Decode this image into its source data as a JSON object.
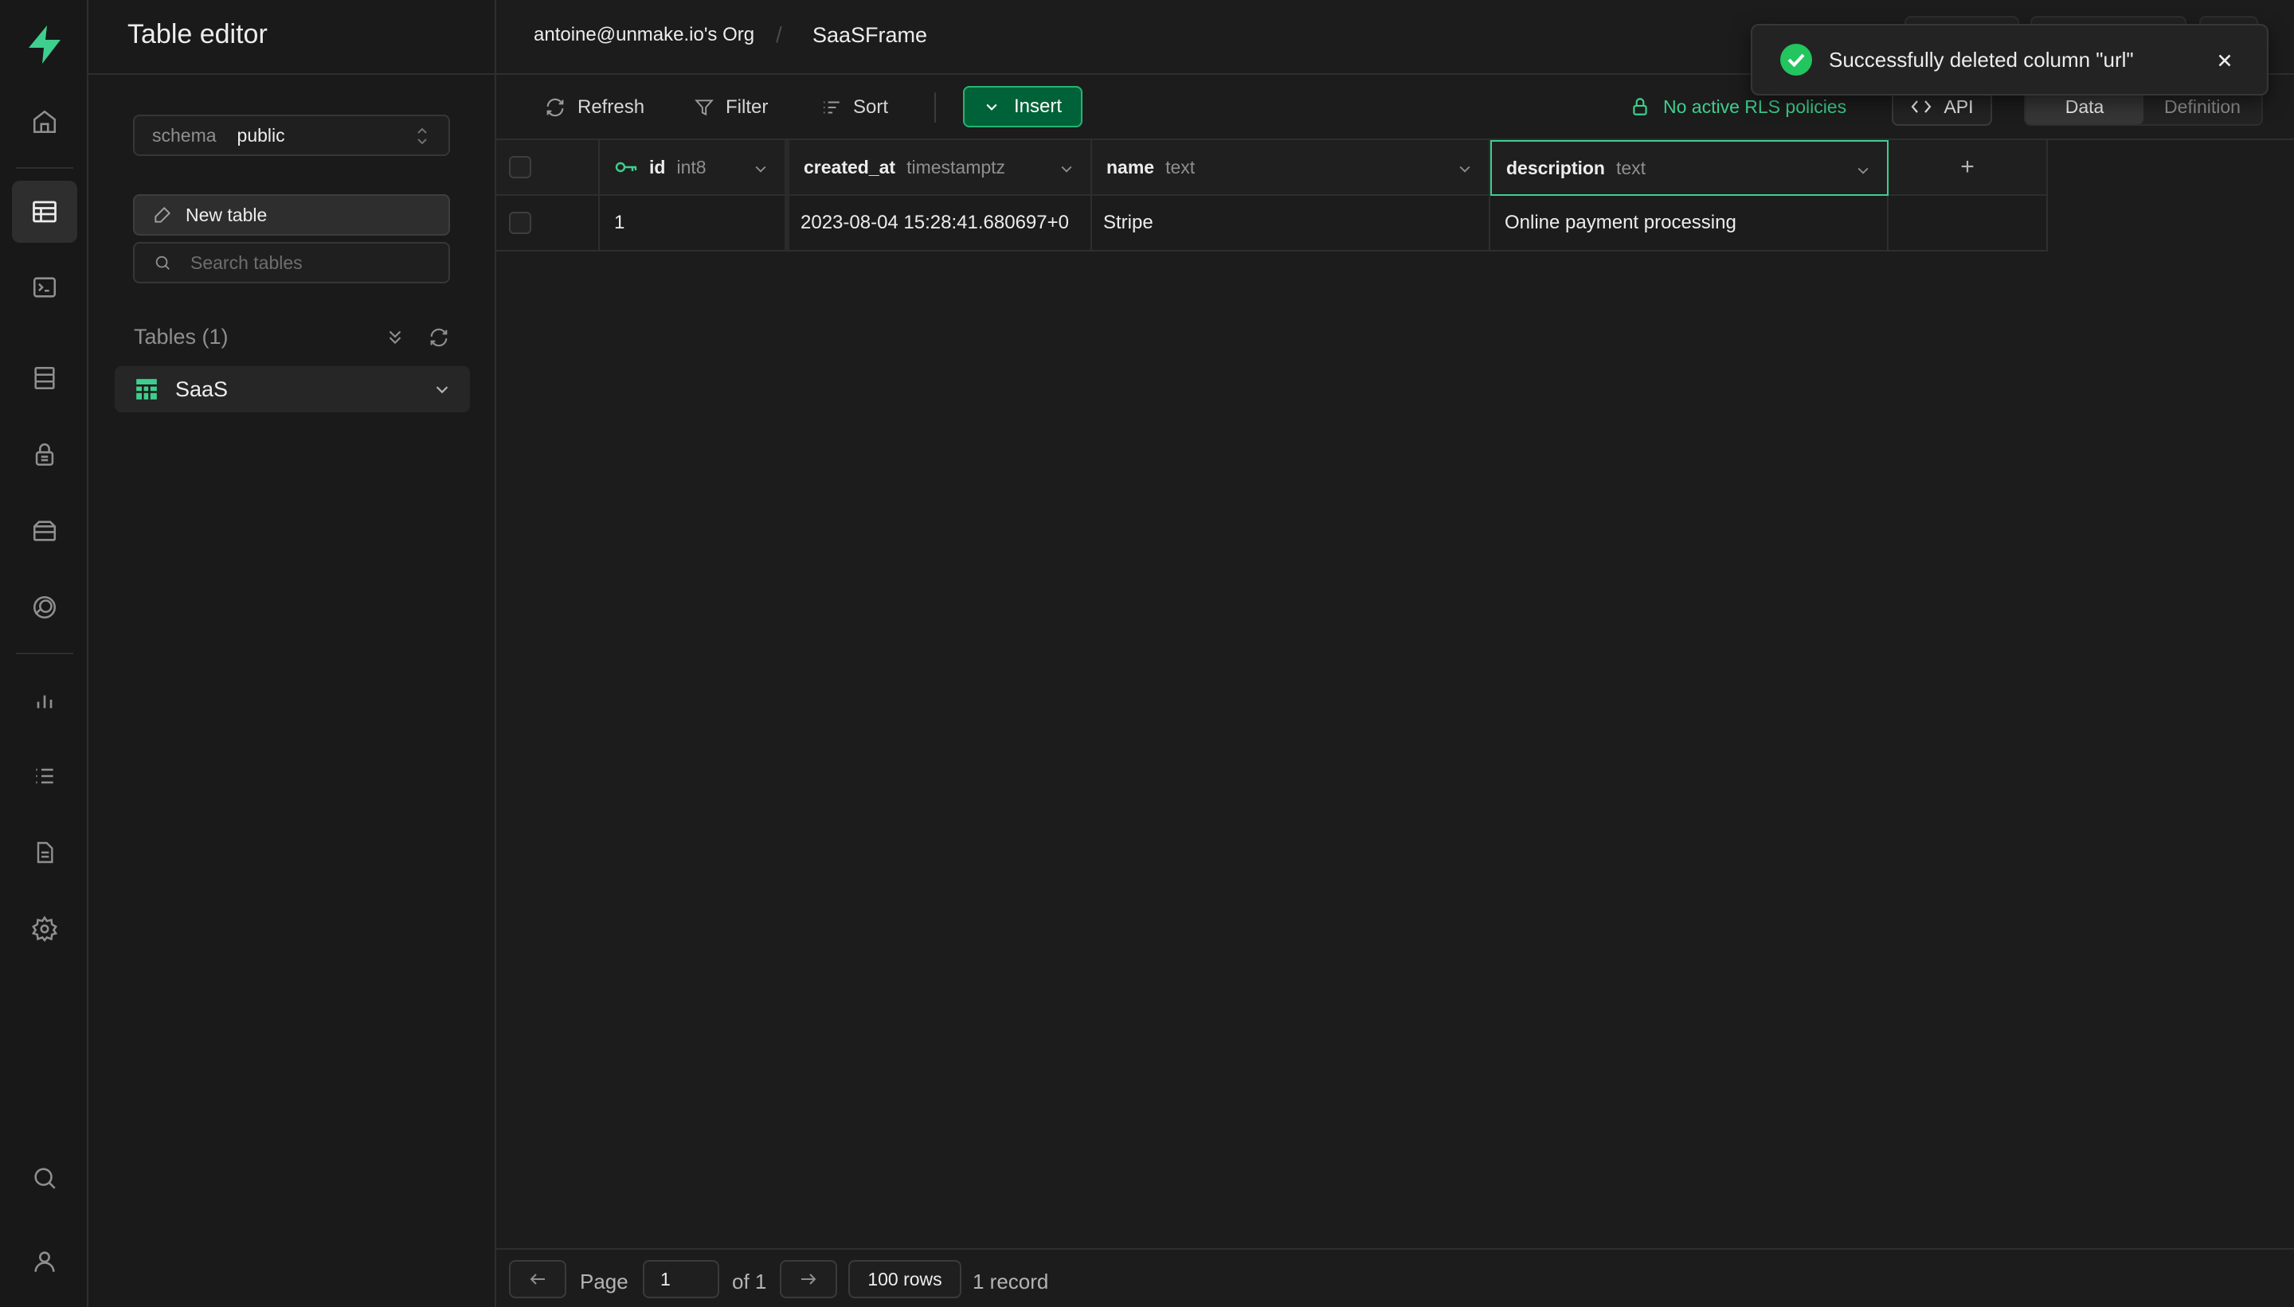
{
  "colors": {
    "brand": "#3ecf8e",
    "insert_bg": "#006239",
    "background": "#1c1c1c"
  },
  "rail": {
    "items": [
      {
        "name": "home-icon"
      },
      {
        "name": "table-editor-icon",
        "active": true
      },
      {
        "name": "sql-editor-icon"
      },
      {
        "name": "database-icon"
      },
      {
        "name": "auth-icon"
      },
      {
        "name": "storage-icon"
      },
      {
        "name": "realtime-icon"
      },
      {
        "name": "reports-icon"
      },
      {
        "name": "logs-icon"
      },
      {
        "name": "api-docs-icon"
      },
      {
        "name": "settings-icon"
      },
      {
        "name": "search-icon"
      },
      {
        "name": "user-icon"
      }
    ]
  },
  "sidebar": {
    "title": "Table editor",
    "schema_label": "schema",
    "schema_value": "public",
    "new_table_label": "New table",
    "search_placeholder": "Search tables",
    "tables_heading": "Tables (1)",
    "tables": [
      {
        "name": "SaaS"
      }
    ]
  },
  "topbar": {
    "org": "antoine@unmake.io's Org",
    "separator": "/",
    "project": "SaaSFrame"
  },
  "toolbar": {
    "refresh": "Refresh",
    "filter": "Filter",
    "sort": "Sort",
    "insert": "Insert",
    "rls": "No active RLS policies",
    "api": "API",
    "view_data": "Data",
    "view_definition": "Definition"
  },
  "grid": {
    "columns": [
      {
        "name": "id",
        "type": "int8",
        "primary_key": true
      },
      {
        "name": "created_at",
        "type": "timestamptz"
      },
      {
        "name": "name",
        "type": "text"
      },
      {
        "name": "description",
        "type": "text",
        "focused": true
      }
    ],
    "add_column": "+",
    "rows": [
      {
        "id": "1",
        "created_at": "2023-08-04 15:28:41.680697+0",
        "name": "Stripe",
        "description": "Online payment processing"
      }
    ]
  },
  "footer": {
    "page_label": "Page",
    "page_value": "1",
    "of_label": "of 1",
    "rows_label": "100 rows",
    "record_count": "1 record"
  },
  "toast": {
    "message": "Successfully deleted column \"url\""
  }
}
